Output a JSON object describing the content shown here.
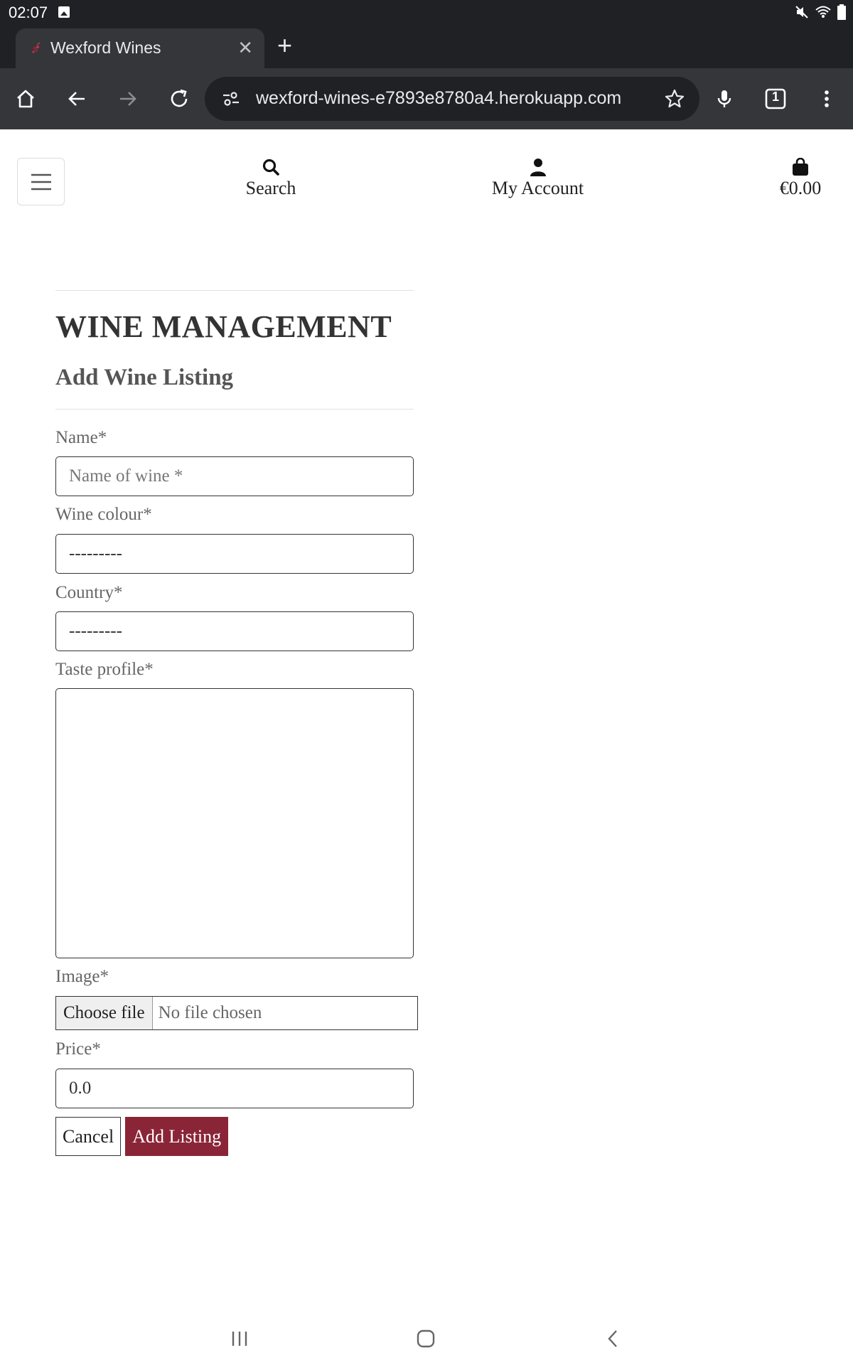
{
  "status_bar": {
    "time": "02:07",
    "icons": [
      "image-notification-icon",
      "mute-icon",
      "wifi-icon",
      "battery-icon"
    ]
  },
  "browser": {
    "tab_title": "Wexford Wines",
    "tab_close_icon": "close-icon",
    "new_tab_icon": "plus-icon",
    "url": "wexford-wines-e7893e8780a4.herokuapp.com",
    "tab_count": "1",
    "toolbar_icons": [
      "home-icon",
      "back-arrow-icon",
      "forward-arrow-icon",
      "reload-icon",
      "site-info-icon",
      "bookmark-star-icon",
      "microphone-icon",
      "tab-switcher-icon",
      "more-vert-icon"
    ]
  },
  "header": {
    "menu_icon": "hamburger-menu-icon",
    "search_label": "Search",
    "account_label": "My Account",
    "bag_total": "€0.00",
    "search_icon": "search-icon",
    "account_icon": "user-icon",
    "bag_icon": "shopping-bag-icon"
  },
  "page": {
    "title": "WINE MANAGEMENT",
    "subtitle": "Add Wine Listing"
  },
  "form": {
    "name_label": "Name*",
    "name_placeholder": "Name of wine *",
    "colour_label": "Wine colour*",
    "colour_value": "---------",
    "country_label": "Country*",
    "country_value": "---------",
    "taste_label": "Taste profile*",
    "taste_value": "",
    "image_label": "Image*",
    "choose_file": "Choose file",
    "no_file": "No file chosen",
    "price_label": "Price*",
    "price_value": "0.0",
    "cancel_label": "Cancel",
    "submit_label": "Add Listing"
  },
  "colors": {
    "accent": "#8a2537",
    "browser_dark": "#202124",
    "toolbar": "#35363a"
  },
  "system_nav": {
    "icons": [
      "recent-apps-icon",
      "home-pill-icon",
      "system-back-icon"
    ]
  }
}
